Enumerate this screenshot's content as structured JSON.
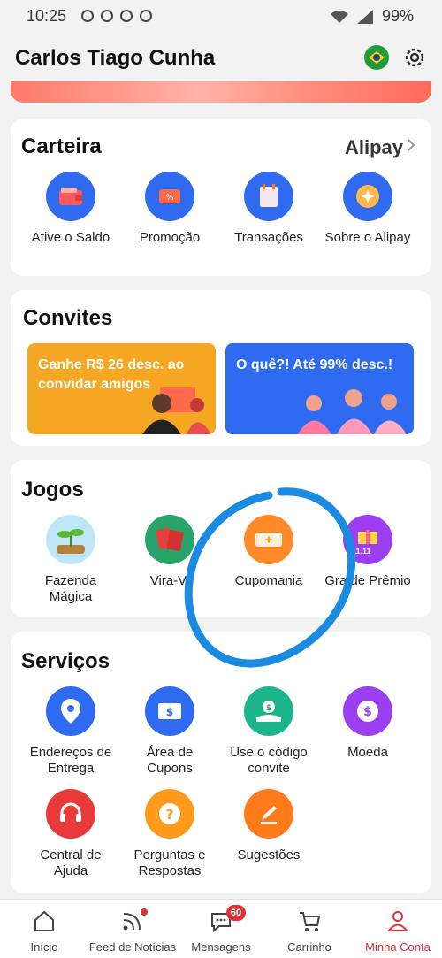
{
  "status_bar": {
    "time": "10:25",
    "battery": "99%"
  },
  "header": {
    "user_name": "Carlos Tiago  Cunha"
  },
  "wallet": {
    "title": "Carteira",
    "brand": "Alipay",
    "items": [
      {
        "label": "Ative o Saldo",
        "icon": "wallet-icon"
      },
      {
        "label": "Promoção",
        "icon": "coupon-ticket-icon"
      },
      {
        "label": "Transações",
        "icon": "notepad-icon"
      },
      {
        "label": "Sobre o Alipay",
        "icon": "alipay-sparkle-icon"
      }
    ]
  },
  "invites": {
    "title": "Convites",
    "cards": [
      {
        "text": "Ganhe R$ 26 desc. ao convidar amigos"
      },
      {
        "text": "O quê?! Até 99% desc.!"
      }
    ]
  },
  "games": {
    "title": "Jogos",
    "items": [
      {
        "label": "Fazenda\nMágica",
        "icon": "plant-icon"
      },
      {
        "label": "Vira-Vi",
        "icon": "cards-icon"
      },
      {
        "label": "Cupomania",
        "icon": "coupon-sparkle-icon"
      },
      {
        "label": "Gra  de Prêmio",
        "icon": "gift-11-11-icon",
        "badge": "11.11"
      }
    ]
  },
  "services": {
    "title": "Serviços",
    "items": [
      {
        "label": "Endereços de\nEntrega",
        "icon": "location-pin-icon"
      },
      {
        "label": "Área de\nCupons",
        "icon": "dollar-coupon-icon"
      },
      {
        "label": "Use o código\nconvite",
        "icon": "hand-coin-icon"
      },
      {
        "label": "Moeda",
        "icon": "coin-icon"
      },
      {
        "label": "Central de\nAjuda",
        "icon": "headset-icon"
      },
      {
        "label": "Perguntas e\nRespostas",
        "icon": "question-icon"
      },
      {
        "label": "Sugestões",
        "icon": "pen-icon"
      }
    ]
  },
  "bottom_nav": [
    {
      "label": "Início",
      "icon": "home-icon"
    },
    {
      "label": "Feed de Notícias",
      "icon": "rss-icon"
    },
    {
      "label": "Mensagens",
      "icon": "chat-icon",
      "badge": "60"
    },
    {
      "label": "Carrinho",
      "icon": "cart-icon"
    },
    {
      "label": "Minha Conta",
      "icon": "person-icon",
      "active": true
    }
  ],
  "colors": {
    "accent_red": "#e0313a",
    "blue_icon": "#2f6bf0",
    "orange_icon": "#ff7a1a",
    "purple_icon": "#9b3ff0",
    "annotation_blue": "#1a8be0"
  }
}
